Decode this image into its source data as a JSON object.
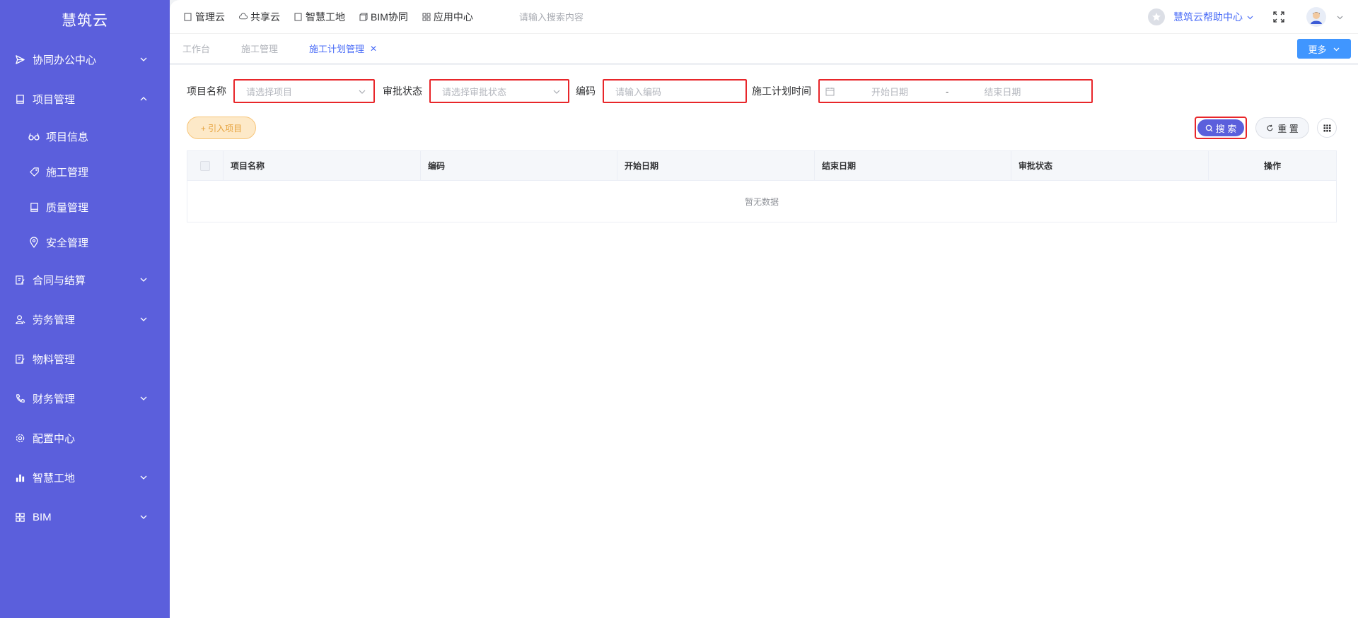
{
  "app": {
    "logo_text": "慧筑云"
  },
  "sidebar": {
    "items": [
      {
        "label": "协同办公中心",
        "icon": "send-icon",
        "expandable": true,
        "expanded": false
      },
      {
        "label": "项目管理",
        "icon": "book-icon",
        "expandable": true,
        "expanded": true,
        "children": [
          {
            "label": "项目信息",
            "icon": "glasses-icon"
          },
          {
            "label": "施工管理",
            "icon": "tag-icon"
          },
          {
            "label": "质量管理",
            "icon": "book-icon"
          },
          {
            "label": "安全管理",
            "icon": "location-pin-icon"
          }
        ]
      },
      {
        "label": "合同与结算",
        "icon": "edit-document-icon",
        "expandable": true,
        "expanded": false
      },
      {
        "label": "劳务管理",
        "icon": "worker-icon",
        "expandable": true,
        "expanded": false
      },
      {
        "label": "物料管理",
        "icon": "edit-document-icon",
        "expandable": false
      },
      {
        "label": "财务管理",
        "icon": "phone-icon",
        "expandable": true,
        "expanded": false
      },
      {
        "label": "配置中心",
        "icon": "gear-icon",
        "expandable": false
      },
      {
        "label": "智慧工地",
        "icon": "bar-chart-icon",
        "expandable": true,
        "expanded": false
      },
      {
        "label": "BIM",
        "icon": "grid-apps-icon",
        "expandable": true,
        "expanded": false
      }
    ]
  },
  "topbar": {
    "nav": [
      {
        "label": "管理云",
        "icon": "document-icon"
      },
      {
        "label": "共享云",
        "icon": "cloud-icon"
      },
      {
        "label": "智慧工地",
        "icon": "document-icon"
      },
      {
        "label": "BIM协同",
        "icon": "cube-icon"
      },
      {
        "label": "应用中心",
        "icon": "grid-apps-icon"
      }
    ],
    "search_placeholder": "请输入搜索内容",
    "help_label": "慧筑云帮助中心"
  },
  "tabs": [
    {
      "label": "工作台",
      "active": false
    },
    {
      "label": "施工管理",
      "active": false
    },
    {
      "label": "施工计划管理",
      "active": true,
      "closable": true
    }
  ],
  "more_label": "更多",
  "filter": {
    "project_label": "项目名称",
    "project_placeholder": "请选择项目",
    "status_label": "审批状态",
    "status_placeholder": "请选择审批状态",
    "code_label": "编码",
    "code_placeholder": "请输入编码",
    "time_label": "施工计划时间",
    "start_placeholder": "开始日期",
    "separator": "-",
    "end_placeholder": "结束日期"
  },
  "actions": {
    "import_label": "+ 引入项目",
    "search_label": "搜 索",
    "reset_label": "重 置"
  },
  "table": {
    "columns": [
      "项目名称",
      "编码",
      "开始日期",
      "结束日期",
      "审批状态",
      "操作"
    ],
    "rows": [],
    "empty_text": "暂无数据"
  },
  "colors": {
    "sidebar_bg": "#5b5fdc",
    "accent": "#4a6cf7",
    "highlight_border": "#e8262a",
    "more_button": "#4096ff"
  }
}
